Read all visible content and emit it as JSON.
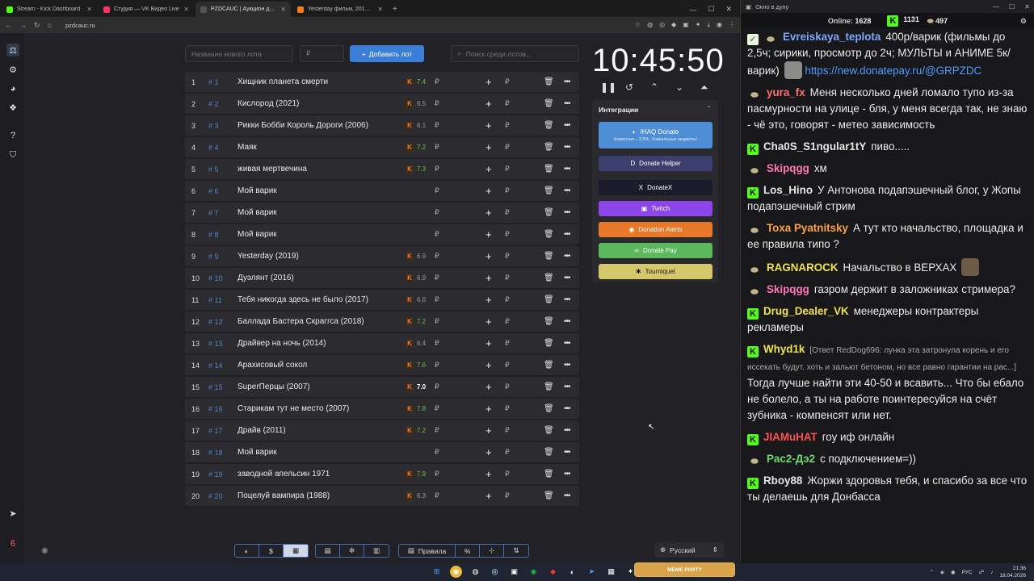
{
  "browser": {
    "tabs": [
      {
        "title": "Stream - Kick Dashboard",
        "color": "#53fc18",
        "active": false
      },
      {
        "title": "Студия — VK Видео Live",
        "color": "#ff3366",
        "active": false
      },
      {
        "title": "PZDCAUC | Аукцион для стри...",
        "color": "#555555",
        "active": true
      },
      {
        "title": "Yesterday фильм, 2019, дата в...",
        "color": "#f57c1f",
        "active": false
      }
    ],
    "url": "pzdcauc.ru"
  },
  "auction": {
    "new_lot_placeholder": "Название нового лота",
    "amount_placeholder": "₽",
    "add_button": "Добавить лот",
    "search_placeholder": "Поиск среди лотов...",
    "timer": "10:45:50",
    "currency": "₽",
    "lots": [
      {
        "n": "1",
        "id": "# 1",
        "name": "Хищник планета смерти",
        "rating": "7.4"
      },
      {
        "n": "2",
        "id": "# 2",
        "name": "Кислород (2021)",
        "rating": "6.5"
      },
      {
        "n": "3",
        "id": "# 3",
        "name": "Рикки Бобби Король Дороги (2006)",
        "rating": "6.1"
      },
      {
        "n": "4",
        "id": "# 4",
        "name": "Маяк",
        "rating": "7.2"
      },
      {
        "n": "5",
        "id": "# 5",
        "name": "живая мертвечина",
        "rating": "7.3"
      },
      {
        "n": "6",
        "id": "# 6",
        "name": "Мой варик",
        "rating": ""
      },
      {
        "n": "7",
        "id": "# 7",
        "name": "Мой варик",
        "rating": ""
      },
      {
        "n": "8",
        "id": "# 8",
        "name": "Мой варик",
        "rating": ""
      },
      {
        "n": "9",
        "id": "# 9",
        "name": "Yesterday (2019)",
        "rating": "6.9"
      },
      {
        "n": "10",
        "id": "# 10",
        "name": "Дуэлянт (2016)",
        "rating": "6.9"
      },
      {
        "n": "11",
        "id": "# 11",
        "name": " Тебя никогда здесь не было (2017)",
        "rating": "6.6"
      },
      {
        "n": "12",
        "id": "# 12",
        "name": "Баллада Бастера Скраггса (2018)",
        "rating": "7.2"
      },
      {
        "n": "13",
        "id": "# 13",
        "name": "Драйвер на ночь (2014)",
        "rating": "6.4"
      },
      {
        "n": "14",
        "id": "# 14",
        "name": "Арахисовый сокол",
        "rating": "7.6"
      },
      {
        "n": "15",
        "id": "# 15",
        "name": "SuperПерцы (2007)",
        "rating": "7.0"
      },
      {
        "n": "16",
        "id": "# 16",
        "name": "Старикам тут не место (2007)",
        "rating": "7.8"
      },
      {
        "n": "17",
        "id": "# 17",
        "name": "Драйв (2011)",
        "rating": "7.2"
      },
      {
        "n": "18",
        "id": "# 18",
        "name": "Мой варик",
        "rating": ""
      },
      {
        "n": "19",
        "id": "# 19",
        "name": "заводной апельсин 1971",
        "rating": "7.9"
      },
      {
        "n": "20",
        "id": "# 20",
        "name": "Поцелуй вампира (1988)",
        "rating": "6.3"
      }
    ]
  },
  "integrations": {
    "title": "Интеграции",
    "buttons": [
      {
        "label": "IHAQ Donate",
        "sub": "Комиссия – 3,5%. Уникальные виджеты!",
        "color": "#4d8ed6",
        "icon": "ihaq-icon",
        "glyph": "◐"
      },
      {
        "label": "Donate Helper",
        "sub": "",
        "color": "#3a3f6e",
        "icon": "donatehelper-icon",
        "glyph": "D"
      },
      {
        "label": "DonateX",
        "sub": "",
        "color": "#1b1b2a",
        "icon": "donatex-icon",
        "glyph": "X"
      },
      {
        "label": "Twitch",
        "sub": "",
        "color": "#8b45e8",
        "icon": "twitch-icon",
        "glyph": "▣"
      },
      {
        "label": "Donation Alerts",
        "sub": "",
        "color": "#e8782a",
        "icon": "donationalerts-icon",
        "glyph": "◉"
      },
      {
        "label": "Donate Pay",
        "sub": "",
        "color": "#5cb85c",
        "icon": "donatepay-icon",
        "glyph": "∞"
      },
      {
        "label": "Tourniquet",
        "sub": "",
        "color": "#d4c86a",
        "icon": "tourniquet-icon",
        "glyph": "✱"
      }
    ]
  },
  "bottom": {
    "rules_label": "Правила",
    "language": "Русский"
  },
  "chat": {
    "window_title": "Окно в духу",
    "online_label": "Online:",
    "online_count": "1628",
    "kick_count": "1131",
    "vk_count": "497",
    "messages": [
      {
        "badge": "check",
        "gun": true,
        "nick": "Evreiskaya_teplota",
        "nick_color": "#7ba7ff",
        "text": "400р/варик (фильмы до 2,5ч; сирики, просмотр до 2ч; МУЛЬТЫ и АНИМЕ 5к/варик)",
        "link": "https://new.donatepay.ru/@GRPZDC",
        "emote": "g"
      },
      {
        "badge": "gun",
        "nick": "yura_fx",
        "nick_color": "#ff6f6f",
        "text": "Меня несколько дней ломало тупо из-за пасмурности на улице - бля, у меня всегда так, не знаю - чё это, говорят - метео зависимость"
      },
      {
        "badge": "kick",
        "nick": "Cha0S_S1ngular1tY",
        "nick_color": "#e6e6e6",
        "text": "пиво....."
      },
      {
        "badge": "gun",
        "nick": "Skipqgg",
        "nick_color": "#ff77b8",
        "text": "хм"
      },
      {
        "badge": "kick",
        "nick": "Los_Hino",
        "nick_color": "#e6e6e6",
        "text": "У Антонова подапэшечный блог, у Жопы подапэшечный стрим"
      },
      {
        "badge": "gun",
        "nick": "Toxa Pyatnitsky",
        "nick_color": "#ffa23a",
        "text": "А тут кто начальство, площадка и ее правила типо ?"
      },
      {
        "badge": "gun",
        "nick": "RAGNAROCK",
        "nick_color": "#f0e24a",
        "text": "Начальство в ВЕРХАХ",
        "emote": "f"
      },
      {
        "badge": "gun",
        "nick": "Skipqgg",
        "nick_color": "#ff77b8",
        "text": "газром держит в заложниках стримера?"
      },
      {
        "badge": "kick",
        "nick": "Drug_Dealer_VK",
        "nick_color": "#f0e24a",
        "text": "менеджеры контрактеры рекламеры"
      },
      {
        "badge": "kick",
        "nick": "Whyd1k",
        "nick_color": "#f0e24a",
        "reply": "[Ответ RedDog696: лунка эта затронула корень и его иссекать будут. хоть и зальют бетоном, но все равно гарантии на рас...]",
        "text": "Тогда лучше найти эти 40-50 и всавить... Что бы ебало не болело, а ты на работе поинтересуйся на счёт зубника - компенсят или нет."
      },
      {
        "badge": "kick",
        "nick": "JIAMuHAT",
        "nick_color": "#ff5252",
        "text": "гоу иф онлайн"
      },
      {
        "badge": "gun",
        "nick": "Pac2-Дэ2",
        "nick_color": "#6cd96c",
        "text": "с подключением=))"
      },
      {
        "badge": "kick",
        "nick": "Rboy88",
        "nick_color": "#e6e6e6",
        "text": "Жоржи здоровья тебя, и спасибо за все что ты делаешь для Донбасса"
      }
    ]
  },
  "taskbar": {
    "meme_label": "MEME PARTY",
    "lang": "РУС",
    "time": "21:36",
    "date": "18.04.2026"
  }
}
